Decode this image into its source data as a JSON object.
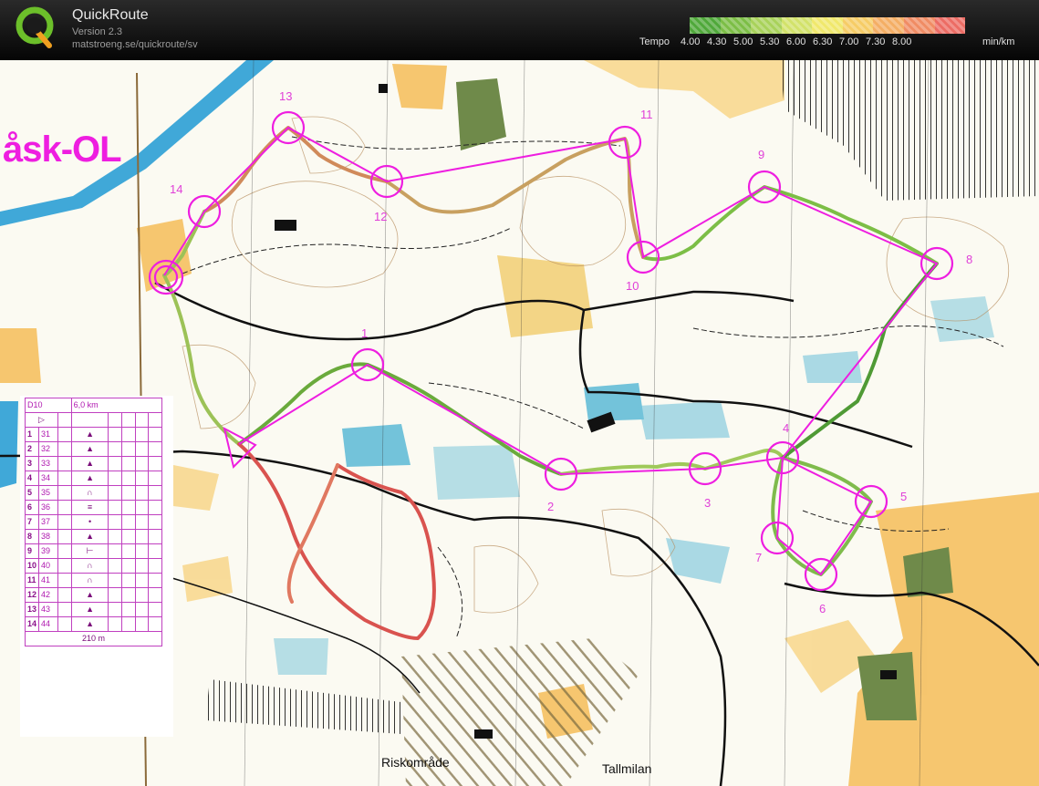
{
  "app": {
    "title": "QuickRoute",
    "version": "Version 2.3",
    "url": "matstroeng.se/quickroute/sv",
    "logo_letter": "Q"
  },
  "tempo": {
    "label": "Tempo",
    "ticks": [
      "4.00",
      "4.30",
      "5.00",
      "5.30",
      "6.00",
      "6.30",
      "7.00",
      "7.30",
      "8.00"
    ],
    "unit": "min/km",
    "colors": [
      "#4fa83a",
      "#7cbe46",
      "#a8d25a",
      "#d2e26a",
      "#f0e86c",
      "#f6cc66",
      "#f4ae64",
      "#f08c64",
      "#ec6c64"
    ]
  },
  "map": {
    "event_title": "åsk-OL",
    "place_names": [
      "Riskområde",
      "Tallmilan"
    ],
    "control_numbers": [
      "1",
      "2",
      "3",
      "4",
      "5",
      "6",
      "7",
      "8",
      "9",
      "10",
      "11",
      "12",
      "13",
      "14"
    ],
    "colors": {
      "course": "#ee1ee0",
      "route_fast": "#4f9a35",
      "route_slow": "#d9534f",
      "paper": "#fbfaf2",
      "open_land": "#f5c060",
      "marsh": "#46b0d2",
      "water": "#40a8d8"
    }
  },
  "control_description": {
    "class": "D10",
    "length": "6,0 km",
    "start_symbol": "▷",
    "scale_text": "210 m",
    "rows": [
      {
        "num": "1",
        "code": "31",
        "symbol": "▲"
      },
      {
        "num": "2",
        "code": "32",
        "symbol": "▲"
      },
      {
        "num": "3",
        "code": "33",
        "symbol": "▲"
      },
      {
        "num": "4",
        "code": "34",
        "symbol": "▲"
      },
      {
        "num": "5",
        "code": "35",
        "symbol": "∩"
      },
      {
        "num": "6",
        "code": "36",
        "symbol": "≡"
      },
      {
        "num": "7",
        "code": "37",
        "symbol": "•"
      },
      {
        "num": "8",
        "code": "38",
        "symbol": "▲"
      },
      {
        "num": "9",
        "code": "39",
        "symbol": "⊢"
      },
      {
        "num": "10",
        "code": "40",
        "symbol": "∩"
      },
      {
        "num": "11",
        "code": "41",
        "symbol": "∩"
      },
      {
        "num": "12",
        "code": "42",
        "symbol": "▲"
      },
      {
        "num": "13",
        "code": "43",
        "symbol": "▲"
      },
      {
        "num": "14",
        "code": "44",
        "symbol": "▲"
      }
    ]
  }
}
